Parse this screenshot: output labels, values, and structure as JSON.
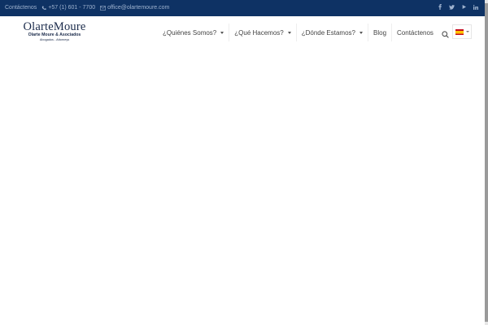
{
  "topbar": {
    "contact_label": "Contáctenos",
    "phone": "+57 (1) 601 - 7700",
    "email": "office@olartemoure.com",
    "social_icons": [
      "facebook-icon",
      "twitter-icon",
      "youtube-icon",
      "linkedin-icon"
    ],
    "background": "#0e3264"
  },
  "logo": {
    "name": "OlarteMoure",
    "subtitle": "Olarte Moure & Asociados",
    "tagline": "Abogados - Attorneys"
  },
  "nav": {
    "items": [
      {
        "label": "¿Quiénes Somos?",
        "has_dropdown": true
      },
      {
        "label": "¿Qué Hacemos?",
        "has_dropdown": true
      },
      {
        "label": "¿Dónde Estamos?",
        "has_dropdown": true
      },
      {
        "label": "Blog",
        "has_dropdown": false
      },
      {
        "label": "Contáctenos",
        "has_dropdown": false
      }
    ],
    "search_icon": "search-icon",
    "language_flag": "spain-flag-icon"
  }
}
